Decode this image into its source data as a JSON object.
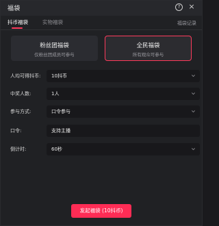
{
  "window": {
    "title": "福袋",
    "help_icon": "?",
    "close_icon": "×"
  },
  "tabs": [
    {
      "label": "抖币福袋",
      "active": true
    },
    {
      "label": "实物福袋",
      "active": false
    }
  ],
  "history_link": "福袋记录",
  "cards": [
    {
      "title": "粉丝团福袋",
      "desc": "仅粉丝团成员可参与",
      "selected": false
    },
    {
      "title": "全民福袋",
      "desc": "所有观众可参与",
      "selected": true
    }
  ],
  "form": {
    "per_person_label": "人均可得抖币:",
    "per_person_value": "10抖币",
    "winners_label": "中奖人数:",
    "winners_value": "1人",
    "method_label": "参与方式:",
    "method_value": "口令参与",
    "password_label": "口令:",
    "password_value": "支持主播",
    "countdown_label": "倒计时:",
    "countdown_value": "60秒"
  },
  "submit_label": "发起福袋 (10抖币)",
  "colors": {
    "accent": "#fe2c55",
    "background": "#202124",
    "field_bg": "#18181b",
    "card_bg": "#2b2c31"
  }
}
